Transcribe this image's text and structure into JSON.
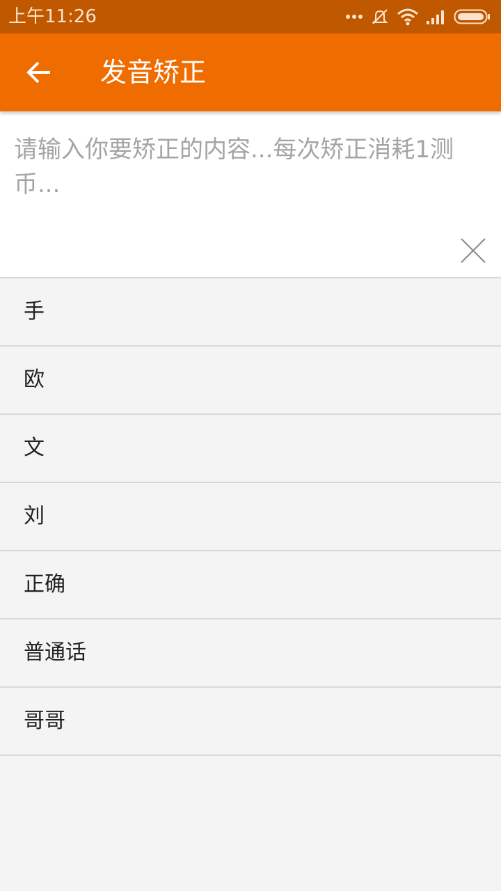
{
  "status_bar": {
    "time": "上午11:26",
    "icons": [
      "more-dots-icon",
      "mute-icon",
      "wifi-icon",
      "signal-icon",
      "battery-icon"
    ]
  },
  "app_bar": {
    "title": "发音矫正",
    "back_icon": "arrow-left-icon",
    "background_color": "#ef6c00"
  },
  "input": {
    "placeholder": "请输入你要矫正的内容...每次矫正消耗1测币...",
    "clear_icon": "close-icon"
  },
  "history": {
    "items": [
      "手",
      "欧",
      "文",
      "刘",
      "正确",
      "普通话",
      "哥哥"
    ]
  }
}
